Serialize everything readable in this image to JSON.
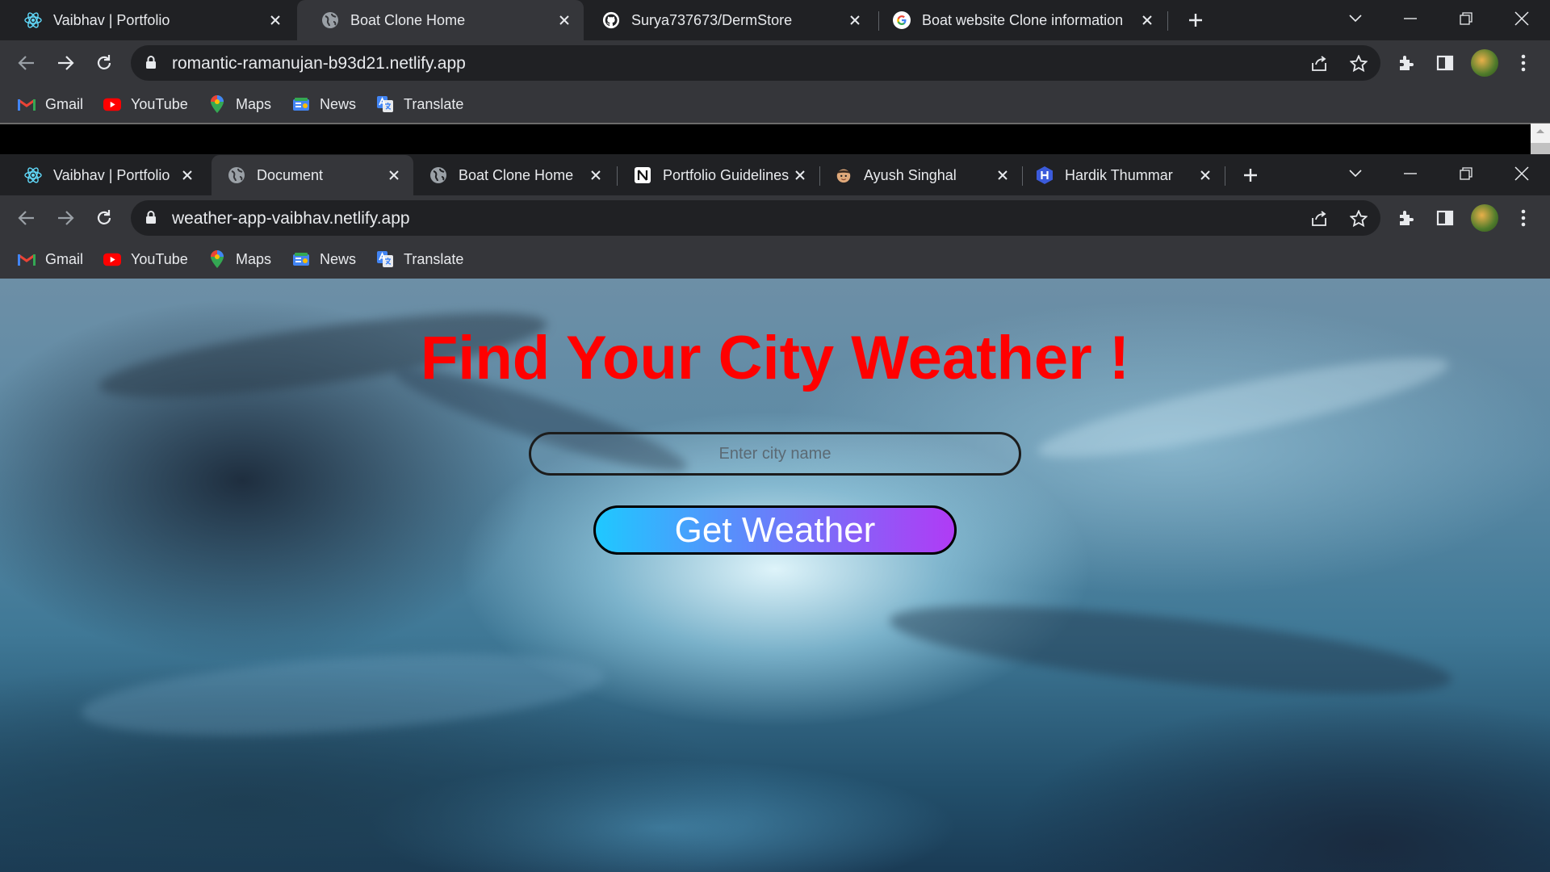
{
  "window1": {
    "tabs": [
      {
        "title": "Vaibhav | Portfolio",
        "icon": "react-icon"
      },
      {
        "title": "Boat Clone Home",
        "icon": "globe-icon"
      },
      {
        "title": "Surya737673/DermStore",
        "icon": "github-icon"
      },
      {
        "title": "Boat website Clone information",
        "icon": "google-icon"
      }
    ],
    "url": "romantic-ramanujan-b93d21.netlify.app"
  },
  "window2": {
    "tabs": [
      {
        "title": "Vaibhav | Portfolio",
        "icon": "react-icon"
      },
      {
        "title": "Document",
        "icon": "globe-icon"
      },
      {
        "title": "Boat Clone Home",
        "icon": "globe-icon"
      },
      {
        "title": "Portfolio Guidelines",
        "icon": "notion-icon"
      },
      {
        "title": "Ayush Singhal",
        "icon": "memoji-icon"
      },
      {
        "title": "Hardik Thummar",
        "icon": "hexagon-h-icon"
      }
    ],
    "url": "weather-app-vaibhav.netlify.app"
  },
  "bookmarks": [
    {
      "label": "Gmail",
      "icon": "gmail-icon"
    },
    {
      "label": "YouTube",
      "icon": "youtube-icon"
    },
    {
      "label": "Maps",
      "icon": "maps-icon"
    },
    {
      "label": "News",
      "icon": "news-icon"
    },
    {
      "label": "Translate",
      "icon": "translate-icon"
    }
  ],
  "app": {
    "heading": "Find Your City Weather !",
    "input_placeholder": "Enter city name",
    "button_label": "Get Weather"
  },
  "colors": {
    "heading": "#ff0000",
    "button_gradient_start": "#1fc8ff",
    "button_gradient_end": "#b03bf5",
    "chrome_frame": "#202124",
    "chrome_toolbar": "#35363a"
  }
}
